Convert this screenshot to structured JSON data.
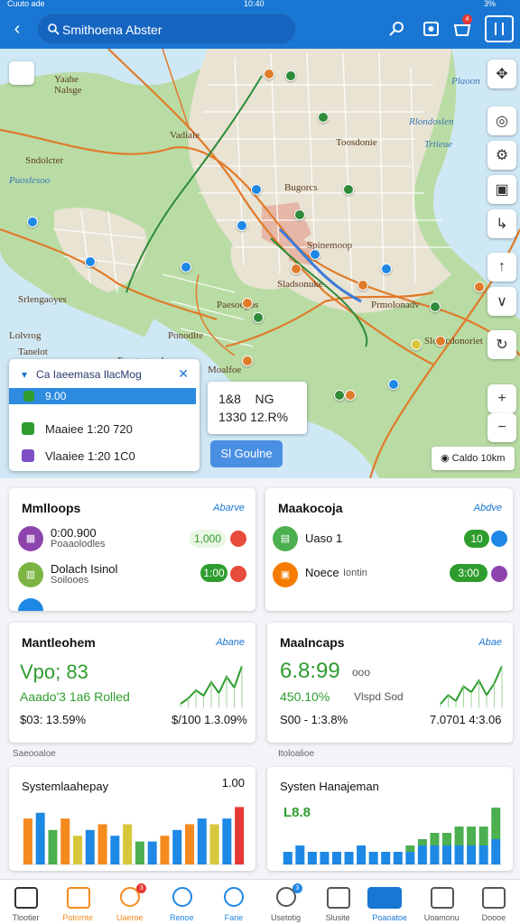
{
  "status": {
    "left": "Cuuto ade",
    "center": "10:40",
    "right": "3%"
  },
  "search": {
    "placeholder": "Smithoena Abster",
    "value": "Smithoena Abster"
  },
  "header": {
    "badge": "4"
  },
  "map": {
    "labels": [
      {
        "text": "Yaahe",
        "water": false
      },
      {
        "text": "Nalsge",
        "water": false
      },
      {
        "text": "Vadiale",
        "water": false
      },
      {
        "text": "Sndolcter",
        "water": false
      },
      {
        "text": "Toosdonie",
        "water": false
      },
      {
        "text": "Bugorcs",
        "water": false
      },
      {
        "text": "Spinemoop",
        "water": false
      },
      {
        "text": "Sladsonuke",
        "water": false
      },
      {
        "text": "Prmolonadv",
        "water": false
      },
      {
        "text": "Slodicdonoriet",
        "water": false
      },
      {
        "text": "Ponodlte",
        "water": false
      },
      {
        "text": "Moalfoe",
        "water": false
      },
      {
        "text": "Paesoopos",
        "water": false
      },
      {
        "text": "Srlengaoyes",
        "water": false
      },
      {
        "text": "Lolvrog",
        "water": false
      },
      {
        "text": "Fapetogoade",
        "water": false
      },
      {
        "text": "Tanelot",
        "water": false
      },
      {
        "text": "Rlondoslen",
        "water": true
      },
      {
        "text": "Trtieue",
        "water": true
      },
      {
        "text": "Plaoon",
        "water": true
      },
      {
        "text": "Puoslesoo",
        "water": true
      }
    ],
    "route_card": {
      "title": "Ca Iaeemasa IlacMog",
      "selected": "9.00",
      "rows": [
        {
          "text": "Maaiee 1:20 720",
          "color": "#2e9d2e"
        },
        {
          "text": "Vlaaiee 1:20 1C0",
          "color": "#7e4fc7"
        }
      ]
    },
    "stat_card": {
      "line1": "1&8    NG",
      "line2": "1330 12.R%"
    },
    "go_button": "Sl Goulne",
    "scale_label": "Caldo 10km"
  },
  "cards": {
    "top_left": {
      "title": "Mmlloops",
      "link": "Abarve",
      "items": [
        {
          "icon": "calendar-icon",
          "icon_color": "#8e44ad",
          "primary": "0:00.900",
          "secondary": "Poaaolodles",
          "pill": "1,000",
          "pill_color": "#e9f6e4",
          "dot_color": "#e74c3c"
        },
        {
          "icon": "chart-icon",
          "icon_color": "#7cb342",
          "primary": "Dolach Isinol",
          "secondary": "Soilooes",
          "pill": "1:00",
          "pill_color": "#2e9d2e",
          "dot_color": "#e74c3c"
        }
      ]
    },
    "top_right": {
      "title": "Maakocoja",
      "link": "Abdve",
      "items": [
        {
          "icon": "document-icon",
          "icon_color": "#4caf50",
          "primary": "Uaso 1",
          "secondary": "",
          "pill": "10",
          "pill_color": "#2e9d2e",
          "dot_color": "#1e88e5"
        },
        {
          "icon": "briefcase-icon",
          "icon_color": "#f57c00",
          "primary": "Noece",
          "secondary": "Iontin",
          "pill": "3:00",
          "pill_color": "#2e9d2e",
          "dot_color": "#8e44ad"
        }
      ]
    },
    "mid_left": {
      "title": "Mantleohem",
      "link": "Abane",
      "big": "Vpo; 83",
      "sub": "Aaado'3 1a6 Rolled",
      "foot_left": "$03: 13.59%",
      "foot_right": "$/100 1.3.09%",
      "trend": [
        4,
        6,
        9,
        7,
        12,
        8,
        14,
        10,
        18
      ]
    },
    "mid_right": {
      "title": "Maalncaps",
      "link": "Abae",
      "big": "6.8:99",
      "big_suffix": "ooo",
      "sub": "450.10%",
      "sub_suffix": "Vlspd Sod",
      "foot_left": "S00 - 1:3.8%",
      "foot_right": "7.0701 4:3.06",
      "trend": [
        5,
        8,
        6,
        11,
        9,
        13,
        8,
        12,
        18
      ]
    },
    "section_left": "Saeooaloe",
    "section_right": "Itoloalioe",
    "bot_left": {
      "title": "Systemlaahepay",
      "value": "1.00"
    },
    "bot_right": {
      "title": "Systen Hanajeman",
      "value": "L8.8"
    }
  },
  "chart_data": [
    {
      "type": "bar",
      "title": "Systemlaahepay",
      "values": [
        8,
        9,
        6,
        8,
        5,
        6,
        7,
        5,
        7,
        4,
        4,
        5,
        6,
        7,
        8,
        7,
        8,
        10
      ],
      "colors": [
        "#f58a1f",
        "#1e88e5",
        "#4caf50",
        "#f58a1f",
        "#d6c83a",
        "#1e88e5",
        "#f58a1f",
        "#1e88e5",
        "#d6c83a",
        "#4caf50",
        "#1e88e5",
        "#f58a1f",
        "#1e88e5",
        "#f58a1f",
        "#1e88e5",
        "#d6c83a",
        "#1e88e5",
        "#e53935"
      ]
    },
    {
      "type": "bar",
      "title": "Systen Hanajeman",
      "series": [
        {
          "name": "",
          "values": [
            2,
            3,
            2,
            2,
            2,
            2,
            3,
            2,
            2,
            2,
            2,
            3,
            3,
            3,
            3,
            3,
            3,
            4
          ],
          "color": "#1e88e5"
        },
        {
          "name": "",
          "values": [
            0,
            0,
            0,
            0,
            0,
            0,
            0,
            0,
            0,
            0,
            1,
            1,
            2,
            2,
            3,
            3,
            3,
            5
          ],
          "color": "#4caf50"
        }
      ]
    }
  ],
  "nav": [
    {
      "label": "Tlootier",
      "icon": "home-icon",
      "color": "#333"
    },
    {
      "label": "Potomte",
      "icon": "calendar-icon",
      "color": "#f58a1f"
    },
    {
      "label": "Uaeroe",
      "icon": "emoji-icon",
      "color": "#f58a1f",
      "badge": "3"
    },
    {
      "label": "Renoe",
      "icon": "circle-icon",
      "color": "#1e88e5"
    },
    {
      "label": "Farie",
      "icon": "search-icon",
      "color": "#1e88e5"
    },
    {
      "label": "Usetotig",
      "icon": "people-icon",
      "color": "#555",
      "badge": "3"
    },
    {
      "label": "Slusite",
      "icon": "chat-icon",
      "color": "#555"
    },
    {
      "label": "Poaoatoe",
      "icon": "dashboard-icon",
      "color": "#fff"
    },
    {
      "label": "Uoamonu",
      "icon": "warning-icon",
      "color": "#555"
    },
    {
      "label": "Doooe",
      "icon": "menu-icon",
      "color": "#555"
    }
  ]
}
